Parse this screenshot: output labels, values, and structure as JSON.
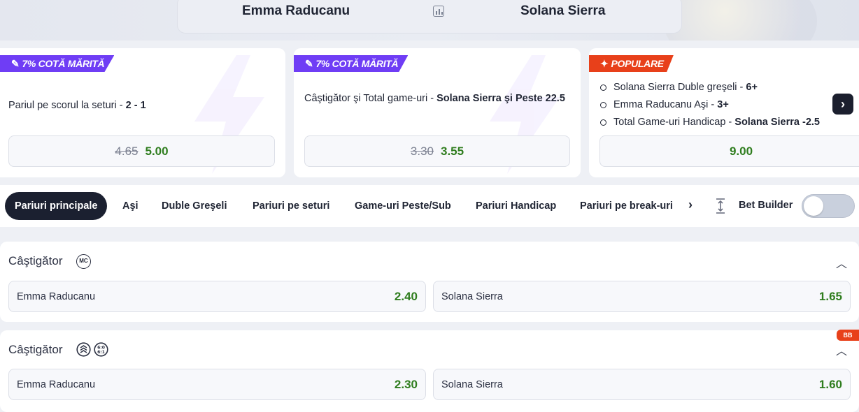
{
  "header": {
    "player1": "Emma Raducanu",
    "player2": "Solana Sierra",
    "stats_icon": "stats-icon"
  },
  "promos": [
    {
      "tag": "7% COTĂ MĂRITĂ",
      "tag_icon": "boost-icon",
      "tag_color": "#6f3df5",
      "market": "Pariul pe scorul la seturi",
      "selection": "2 - 1",
      "old_odd": "4.65",
      "new_odd": "5.00"
    },
    {
      "tag": "7% COTĂ MĂRITĂ",
      "tag_icon": "boost-icon",
      "tag_color": "#6f3df5",
      "market": "Câştigător şi Total game-uri",
      "selection": "Solana Sierra şi Peste 22.5",
      "old_odd": "3.30",
      "new_odd": "3.55"
    },
    {
      "tag": "POPULARE",
      "tag_icon": "fire-icon",
      "tag_color": "#e8401a",
      "selections": [
        {
          "market": "Solana Sierra Duble greşeli",
          "value": "6+"
        },
        {
          "market": "Emma Raducanu Aşi",
          "value": "3+"
        },
        {
          "market": "Total Game-uri Handicap",
          "value": "Solana Sierra -2.5"
        }
      ],
      "odd": "9.00"
    }
  ],
  "tabs": [
    "Pariuri principale",
    "Aşi",
    "Duble Greşeli",
    "Pariuri pe seturi",
    "Game-uri Peste/Sub",
    "Pariuri Handicap",
    "Pariuri pe break-uri"
  ],
  "bet_builder": {
    "label": "Bet Builder",
    "enabled": false
  },
  "markets": [
    {
      "title": "Câştigător",
      "badge": "MC",
      "outcomes": [
        {
          "name": "Emma Raducanu",
          "odd": "2.40"
        },
        {
          "name": "Solana Sierra",
          "odd": "1.65"
        }
      ]
    },
    {
      "title": "Câştigător",
      "badge_icons": [
        "layers-icon",
        "score-icon"
      ],
      "corner_badge": "BB",
      "outcomes": [
        {
          "name": "Emma Raducanu",
          "odd": "2.30"
        },
        {
          "name": "Solana Sierra",
          "odd": "1.60"
        }
      ]
    }
  ],
  "colors": {
    "odd_green": "#2f7d1e",
    "accent_purple": "#6f3df5",
    "accent_red": "#e8401a",
    "dark": "#1b2030"
  }
}
